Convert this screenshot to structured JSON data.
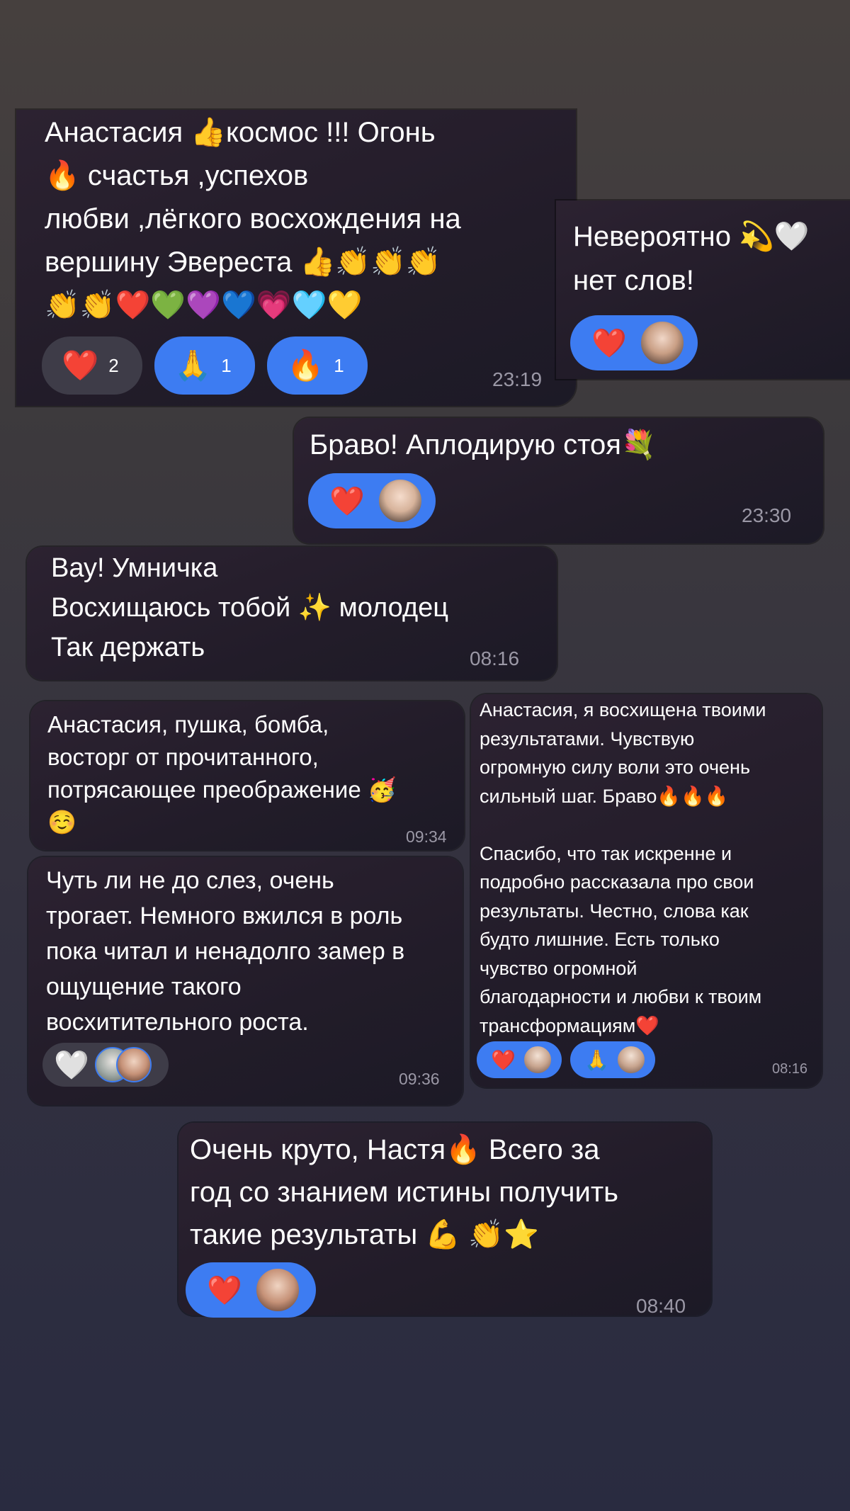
{
  "messages": [
    {
      "text": "Анастасия 👍космос !!! Огонь\n🔥 счастья ,успехов\nлюбви ,лёгкого восхождения на\nвершину Эвереста 👍👏👏👏\n👏👏❤️💚💜💙💗🩵💛",
      "time": "23:19",
      "reactions": [
        {
          "emoji": "❤️",
          "count": "2"
        },
        {
          "emoji": "🙏",
          "count": "1"
        },
        {
          "emoji": "🔥",
          "count": "1"
        }
      ]
    },
    {
      "text": "Невероятно 💫🤍\nнет слов!",
      "reactions": [
        {
          "emoji": "❤️"
        }
      ]
    },
    {
      "text": "Браво! Аплодирую стоя💐",
      "time": "23:30",
      "reactions": [
        {
          "emoji": "❤️"
        }
      ]
    },
    {
      "text": "Вау! Умничка\nВосхищаюсь тобой ✨ молодец\nТак держать",
      "time": "08:16"
    },
    {
      "text": "Анастасия, пушка, бомба,\nвосторг от прочитанного,\nпотрясающее преображение 🥳\n☺️",
      "time": "09:34"
    },
    {
      "text": "Анастасия, я восхищена твоими\nрезультатами. Чувствую\nогромную силу воли это очень\nсильный шаг. Браво🔥🔥🔥\n\nСпасибо, что так искренне и\nподробно рассказала про свои\nрезультаты. Честно, слова как\nбудто лишние. Есть только\nчувство огромной\nблагодарности и любви к твоим\nтрансформациям❤️",
      "time": "08:16",
      "reactions": [
        {
          "emoji": "❤️"
        },
        {
          "emoji": "🙏"
        }
      ]
    },
    {
      "text": "Чуть ли не до слез, очень\nтрогает. Немного вжился в роль\nпока читал и ненадолго замер в\nощущение такого\nвосхитительного роста.",
      "time": "09:36",
      "reactions": [
        {
          "emoji": "🤍"
        }
      ]
    },
    {
      "text": "Очень круто, Настя🔥 Всего за\nгод со знанием истины получить\nтакие результаты 💪 👏⭐️",
      "time": "08:40",
      "reactions": [
        {
          "emoji": "❤️"
        }
      ]
    }
  ]
}
